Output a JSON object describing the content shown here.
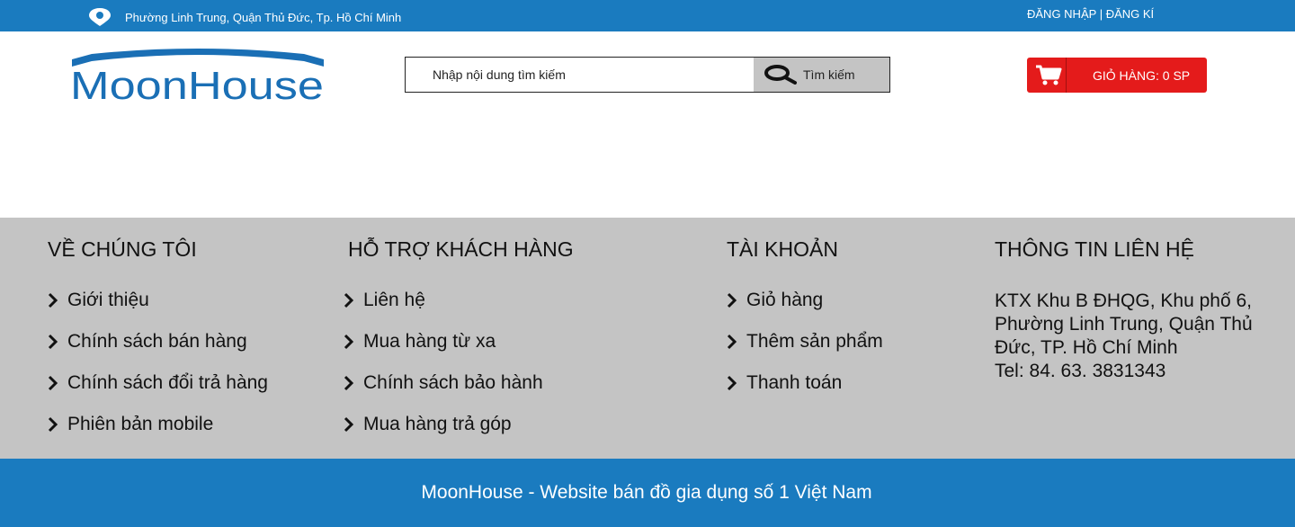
{
  "topbar": {
    "address": "Phường Linh Trung, Quận Thủ Đức, Tp. Hồ Chí Minh",
    "login": "ĐĂNG NHẬP",
    "separator": "|",
    "register": "ĐĂNG KÍ",
    "icon": "location-pin-icon"
  },
  "header": {
    "logo_text": "MoonHouse",
    "search": {
      "placeholder": "Nhập nội dung tìm kiếm",
      "button_label": "Tìm kiếm",
      "icon": "search-icon"
    },
    "cart": {
      "label": "GIỎ HÀNG: 0 SP",
      "icon": "cart-icon"
    }
  },
  "footer": {
    "about": {
      "title": "VỀ CHÚNG TÔI",
      "items": [
        "Giới thiệu",
        "Chính sách bán hàng",
        "Chính sách đổi trả hàng",
        "Phiên bản mobile"
      ]
    },
    "support": {
      "title": "HỖ TRỢ KHÁCH HÀNG",
      "items": [
        "Liên hệ",
        "Mua hàng từ xa",
        "Chính sách bảo hành",
        "Mua hàng trả góp"
      ]
    },
    "account": {
      "title": "TÀI KHOẢN",
      "items": [
        "Giỏ hàng",
        "Thêm sản phẩm",
        "Thanh toán"
      ]
    },
    "contact": {
      "title": "THÔNG TIN LIÊN HỆ",
      "address": "KTX Khu B ĐHQG, Khu phố 6, Phường Linh Trung, Quận Thủ Đức, TP. Hồ Chí Minh",
      "tel": "Tel: 84. 63. 3831343"
    }
  },
  "bottom": {
    "copyright": "MoonHouse - Website bán đồ gia dụng số 1 Việt Nam"
  },
  "colors": {
    "primary_blue": "#1a7bbf",
    "cart_red": "#e41b1b",
    "footer_gray": "#c4c4c4"
  }
}
